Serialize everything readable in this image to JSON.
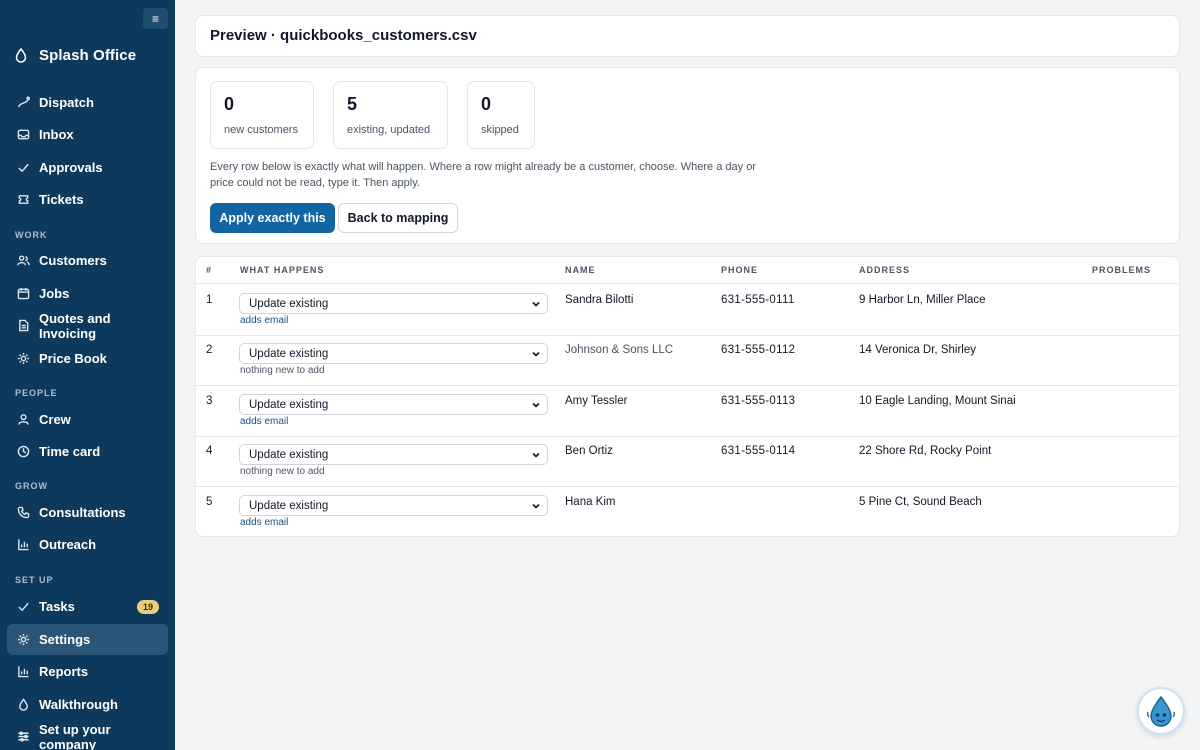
{
  "sidebar": {
    "collapse_icon": "menu-icon",
    "brand": "Splash Office",
    "items": {
      "dispatch": "Dispatch",
      "inbox": "Inbox",
      "approvals": "Approvals",
      "tickets": "Tickets",
      "customers": "Customers",
      "jobs": "Jobs",
      "quotes": "Quotes and Invoicing",
      "pricebook": "Price Book",
      "crew": "Crew",
      "timecard": "Time card",
      "consultations": "Consultations",
      "outreach": "Outreach",
      "tasks": "Tasks",
      "settings": "Settings",
      "reports": "Reports",
      "walkthrough": "Walkthrough",
      "setup": "Set up your company"
    },
    "tasks_badge": "19",
    "sections": {
      "work": "WORK",
      "people": "PEOPLE",
      "grow": "GROW",
      "setup": "SET UP"
    },
    "active": "Settings",
    "color_bg": "#0d3a5c"
  },
  "header": {
    "title": "Preview · quickbooks_customers.csv"
  },
  "summary": {
    "stats": [
      {
        "value": "0",
        "label": "new customers"
      },
      {
        "value": "5",
        "label": "existing, updated"
      },
      {
        "value": "0",
        "label": "skipped"
      }
    ],
    "description": "Every row below is exactly what will happen. Where a row might already be a customer, choose. Where a day or price could not be read, type it. Then apply.",
    "apply_label": "Apply exactly this",
    "back_label": "Back to mapping",
    "accent": "#1264a3"
  },
  "table": {
    "columns": [
      "#",
      "WHAT HAPPENS",
      "NAME",
      "PHONE",
      "ADDRESS",
      "PROBLEMS"
    ],
    "rows": [
      {
        "num": "1",
        "action": "Update existing",
        "note": "adds email",
        "name": "Sandra Bilotti",
        "phone": "631-555-0111",
        "address": "9 Harbor Ln, Miller Place",
        "problems": ""
      },
      {
        "num": "2",
        "action": "Update existing",
        "note": "nothing new to add",
        "name": "Johnson & Sons LLC",
        "phone": "631-555-0112",
        "address": "14 Veronica Dr, Shirley",
        "problems": ""
      },
      {
        "num": "3",
        "action": "Update existing",
        "note": "adds email",
        "name": "Amy Tessler",
        "phone": "631-555-0113",
        "address": "10 Eagle Landing, Mount Sinai",
        "problems": ""
      },
      {
        "num": "4",
        "action": "Update existing",
        "note": "nothing new to add",
        "name": "Ben Ortiz",
        "phone": "631-555-0114",
        "address": "22 Shore Rd, Rocky Point",
        "problems": ""
      },
      {
        "num": "5",
        "action": "Update existing",
        "note": "adds email",
        "name": "Hana Kim",
        "phone": "",
        "address": "5 Pine Ct, Sound Beach",
        "problems": ""
      }
    ]
  },
  "helper_icon": "water-drop-mascot-icon"
}
